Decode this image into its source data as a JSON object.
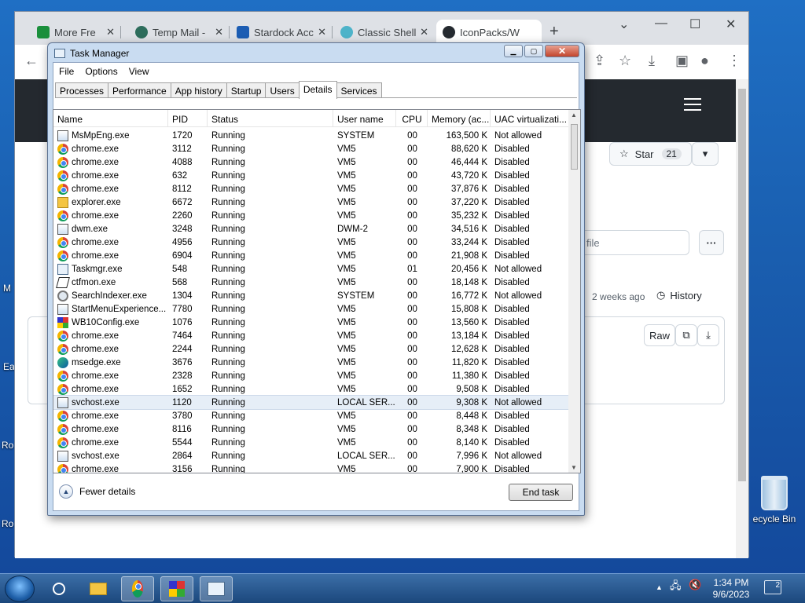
{
  "desktop": {
    "left_icon_labels": [
      "M",
      "Ea",
      "Ro",
      "Ro"
    ],
    "recycle_bin": "ecycle Bin"
  },
  "browser": {
    "tabs": [
      {
        "label": "More Fre",
        "color": "#1a8f3c"
      },
      {
        "label": "Temp Mail -",
        "color": "#2d6d5c"
      },
      {
        "label": "Stardock Acc",
        "color": "#1c5db3"
      },
      {
        "label": "Classic Shell",
        "color": "#4db3c9"
      },
      {
        "label": "IconPacks/W",
        "color": "#24292f"
      }
    ],
    "new_tab": "+",
    "controls": {
      "minimize": "⌄",
      "restore": "—",
      "maximize": "☐",
      "close": "✕"
    },
    "toolbar": {
      "back": "←",
      "share": "⇪",
      "star": "☆",
      "download": "⤓",
      "sidepanel": "▣",
      "profile": "●",
      "menu": "⋮"
    },
    "github": {
      "star_label": "Star",
      "star_count": "21",
      "dropdown": "▾",
      "file_placeholder": "file",
      "more": "···",
      "updated": "2 weeks ago",
      "history": "History",
      "raw": "Raw",
      "copy": "⧉",
      "download": "⤓"
    }
  },
  "taskmanager": {
    "title": "Task Manager",
    "caption": {
      "minimize": "▁",
      "maximize": "▢",
      "close": "✕"
    },
    "menu": [
      "File",
      "Options",
      "View"
    ],
    "tabs": [
      "Processes",
      "Performance",
      "App history",
      "Startup",
      "Users",
      "Details",
      "Services"
    ],
    "active_tab": "Details",
    "columns": [
      "Name",
      "PID",
      "Status",
      "User name",
      "CPU",
      "Memory (ac...",
      "UAC virtualizati..."
    ],
    "rows": [
      {
        "icon": "sys",
        "name": "MsMpEng.exe",
        "pid": "1720",
        "status": "Running",
        "user": "SYSTEM",
        "cpu": "00",
        "mem": "163,500 K",
        "uac": "Not allowed"
      },
      {
        "icon": "chrome",
        "name": "chrome.exe",
        "pid": "3112",
        "status": "Running",
        "user": "VM5",
        "cpu": "00",
        "mem": "88,620 K",
        "uac": "Disabled"
      },
      {
        "icon": "chrome",
        "name": "chrome.exe",
        "pid": "4088",
        "status": "Running",
        "user": "VM5",
        "cpu": "00",
        "mem": "46,444 K",
        "uac": "Disabled"
      },
      {
        "icon": "chrome",
        "name": "chrome.exe",
        "pid": "632",
        "status": "Running",
        "user": "VM5",
        "cpu": "00",
        "mem": "43,720 K",
        "uac": "Disabled"
      },
      {
        "icon": "chrome",
        "name": "chrome.exe",
        "pid": "8112",
        "status": "Running",
        "user": "VM5",
        "cpu": "00",
        "mem": "37,876 K",
        "uac": "Disabled"
      },
      {
        "icon": "explorer",
        "name": "explorer.exe",
        "pid": "6672",
        "status": "Running",
        "user": "VM5",
        "cpu": "00",
        "mem": "37,220 K",
        "uac": "Disabled"
      },
      {
        "icon": "chrome",
        "name": "chrome.exe",
        "pid": "2260",
        "status": "Running",
        "user": "VM5",
        "cpu": "00",
        "mem": "35,232 K",
        "uac": "Disabled"
      },
      {
        "icon": "sys",
        "name": "dwm.exe",
        "pid": "3248",
        "status": "Running",
        "user": "DWM-2",
        "cpu": "00",
        "mem": "34,516 K",
        "uac": "Disabled"
      },
      {
        "icon": "chrome",
        "name": "chrome.exe",
        "pid": "4956",
        "status": "Running",
        "user": "VM5",
        "cpu": "00",
        "mem": "33,244 K",
        "uac": "Disabled"
      },
      {
        "icon": "chrome",
        "name": "chrome.exe",
        "pid": "6904",
        "status": "Running",
        "user": "VM5",
        "cpu": "00",
        "mem": "21,908 K",
        "uac": "Disabled"
      },
      {
        "icon": "tm",
        "name": "Taskmgr.exe",
        "pid": "548",
        "status": "Running",
        "user": "VM5",
        "cpu": "01",
        "mem": "20,456 K",
        "uac": "Not allowed"
      },
      {
        "icon": "ctf",
        "name": "ctfmon.exe",
        "pid": "568",
        "status": "Running",
        "user": "VM5",
        "cpu": "00",
        "mem": "18,148 K",
        "uac": "Disabled"
      },
      {
        "icon": "search",
        "name": "SearchIndexer.exe",
        "pid": "1304",
        "status": "Running",
        "user": "SYSTEM",
        "cpu": "00",
        "mem": "16,772 K",
        "uac": "Not allowed"
      },
      {
        "icon": "sys",
        "name": "StartMenuExperience...",
        "pid": "7780",
        "status": "Running",
        "user": "VM5",
        "cpu": "00",
        "mem": "15,808 K",
        "uac": "Disabled"
      },
      {
        "icon": "wb",
        "name": "WB10Config.exe",
        "pid": "1076",
        "status": "Running",
        "user": "VM5",
        "cpu": "00",
        "mem": "13,560 K",
        "uac": "Disabled"
      },
      {
        "icon": "chrome",
        "name": "chrome.exe",
        "pid": "7464",
        "status": "Running",
        "user": "VM5",
        "cpu": "00",
        "mem": "13,184 K",
        "uac": "Disabled"
      },
      {
        "icon": "chrome",
        "name": "chrome.exe",
        "pid": "2244",
        "status": "Running",
        "user": "VM5",
        "cpu": "00",
        "mem": "12,628 K",
        "uac": "Disabled"
      },
      {
        "icon": "edge",
        "name": "msedge.exe",
        "pid": "3676",
        "status": "Running",
        "user": "VM5",
        "cpu": "00",
        "mem": "11,820 K",
        "uac": "Disabled"
      },
      {
        "icon": "chrome",
        "name": "chrome.exe",
        "pid": "2328",
        "status": "Running",
        "user": "VM5",
        "cpu": "00",
        "mem": "11,380 K",
        "uac": "Disabled"
      },
      {
        "icon": "chrome",
        "name": "chrome.exe",
        "pid": "1652",
        "status": "Running",
        "user": "VM5",
        "cpu": "00",
        "mem": "9,508 K",
        "uac": "Disabled"
      },
      {
        "icon": "sys",
        "name": "svchost.exe",
        "pid": "1120",
        "status": "Running",
        "user": "LOCAL SER...",
        "cpu": "00",
        "mem": "9,308 K",
        "uac": "Not allowed",
        "selected": true
      },
      {
        "icon": "chrome",
        "name": "chrome.exe",
        "pid": "3780",
        "status": "Running",
        "user": "VM5",
        "cpu": "00",
        "mem": "8,448 K",
        "uac": "Disabled"
      },
      {
        "icon": "chrome",
        "name": "chrome.exe",
        "pid": "8116",
        "status": "Running",
        "user": "VM5",
        "cpu": "00",
        "mem": "8,348 K",
        "uac": "Disabled"
      },
      {
        "icon": "chrome",
        "name": "chrome.exe",
        "pid": "5544",
        "status": "Running",
        "user": "VM5",
        "cpu": "00",
        "mem": "8,140 K",
        "uac": "Disabled"
      },
      {
        "icon": "sys",
        "name": "svchost.exe",
        "pid": "2864",
        "status": "Running",
        "user": "LOCAL SER...",
        "cpu": "00",
        "mem": "7,996 K",
        "uac": "Not allowed"
      },
      {
        "icon": "chrome",
        "name": "chrome.exe",
        "pid": "3156",
        "status": "Running",
        "user": "VM5",
        "cpu": "00",
        "mem": "7,900 K",
        "uac": "Disabled"
      }
    ],
    "fewer_details": "Fewer details",
    "end_task": "End task"
  },
  "taskbar": {
    "clock_time": "1:34 PM",
    "clock_date": "9/6/2023",
    "notifications": "2",
    "tray": {
      "chevron": "▲",
      "network": "🖧",
      "volume": "🔇"
    }
  }
}
